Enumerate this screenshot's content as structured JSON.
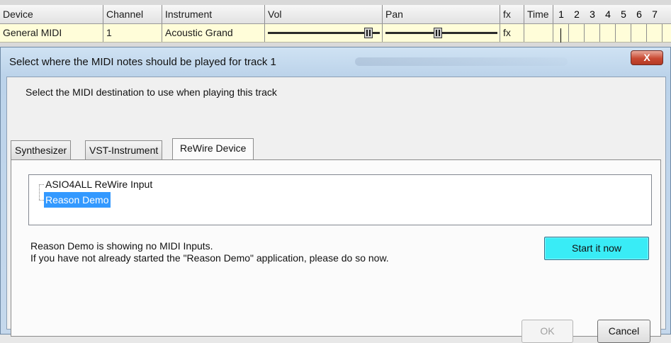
{
  "grid": {
    "headers": {
      "device": "Device",
      "channel": "Channel",
      "instrument": "Instrument",
      "vol": "Vol",
      "pan": "Pan",
      "fx": "fx",
      "time": "Time",
      "measures": [
        "1",
        "2",
        "3",
        "4",
        "5",
        "6",
        "7"
      ]
    },
    "track": {
      "device": "General MIDI",
      "channel": "1",
      "instrument": "Acoustic Grand",
      "fx": "fx"
    }
  },
  "dialog": {
    "title": "Select where the MIDI notes should be played for track 1",
    "close_label": "X",
    "instruction": "Select the MIDI destination to use when playing this track",
    "tabs": [
      {
        "label": "Synthesizer"
      },
      {
        "label": "VST-Instrument"
      },
      {
        "label": "ReWire Device",
        "active": true
      }
    ],
    "tree_items": [
      {
        "label": "ASIO4ALL ReWire Input"
      },
      {
        "label": "Reason Demo",
        "selected": true
      }
    ],
    "message_line1": "Reason Demo is showing no MIDI Inputs.",
    "message_line2": "If you have not already started the \"Reason Demo\" application, please do so now.",
    "start_button": "Start it now",
    "ok_button": "OK",
    "cancel_button": "Cancel"
  },
  "colors": {
    "track_row_bg": "#fffdd9",
    "selection": "#3399ff",
    "start_button_bg": "#39ecf6",
    "close_button": "#c94a33"
  }
}
